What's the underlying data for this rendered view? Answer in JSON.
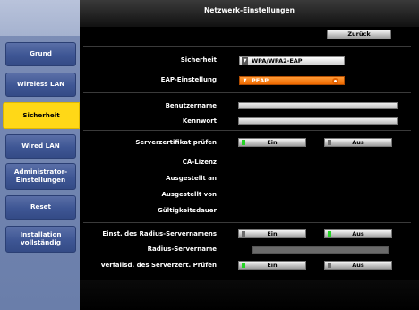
{
  "window": {
    "title": "Netzwerk-Einstellungen",
    "back_label": "Zurück"
  },
  "sidebar": {
    "items": [
      {
        "label": "Grund"
      },
      {
        "label": "Wireless LAN"
      },
      {
        "label": "Sicherheit"
      },
      {
        "label": "Wired LAN"
      },
      {
        "label": "Administrator-Einstellungen"
      },
      {
        "label": "Reset"
      },
      {
        "label": "Installation vollständig"
      }
    ],
    "active": "Sicherheit"
  },
  "form": {
    "security_label": "Sicherheit",
    "security_value": "WPA/WPA2-EAP",
    "eap_label": "EAP-Einstellung",
    "eap_value": "PEAP",
    "username_label": "Benutzername",
    "username_value": "",
    "password_label": "Kennwort",
    "password_value": "",
    "cert_check_label": "Serverzertifikat prüfen",
    "cert_check": {
      "on_label": "Ein",
      "off_label": "Aus",
      "selected": "Ein"
    },
    "ca_license_label": "CA-Lizenz",
    "issued_to_label": "Ausgestellt an",
    "issued_by_label": "Ausgestellt von",
    "validity_label": "Gültigkeitsdauer",
    "radius_name_setting_label": "Einst. des Radius-Servernamens",
    "radius_name_setting": {
      "on_label": "Ein",
      "off_label": "Aus",
      "selected": "Aus"
    },
    "radius_name_label": "Radius-Servername",
    "radius_name_value": "",
    "cert_expiry_label": "Verfallsd. des Serverzert. Prüfen",
    "cert_expiry": {
      "on_label": "Ein",
      "off_label": "Aus",
      "selected": "Ein"
    }
  },
  "colors": {
    "active_nav": "#ffd817",
    "selected_field": "#ef6a00",
    "toggle_on": "#25d325"
  }
}
